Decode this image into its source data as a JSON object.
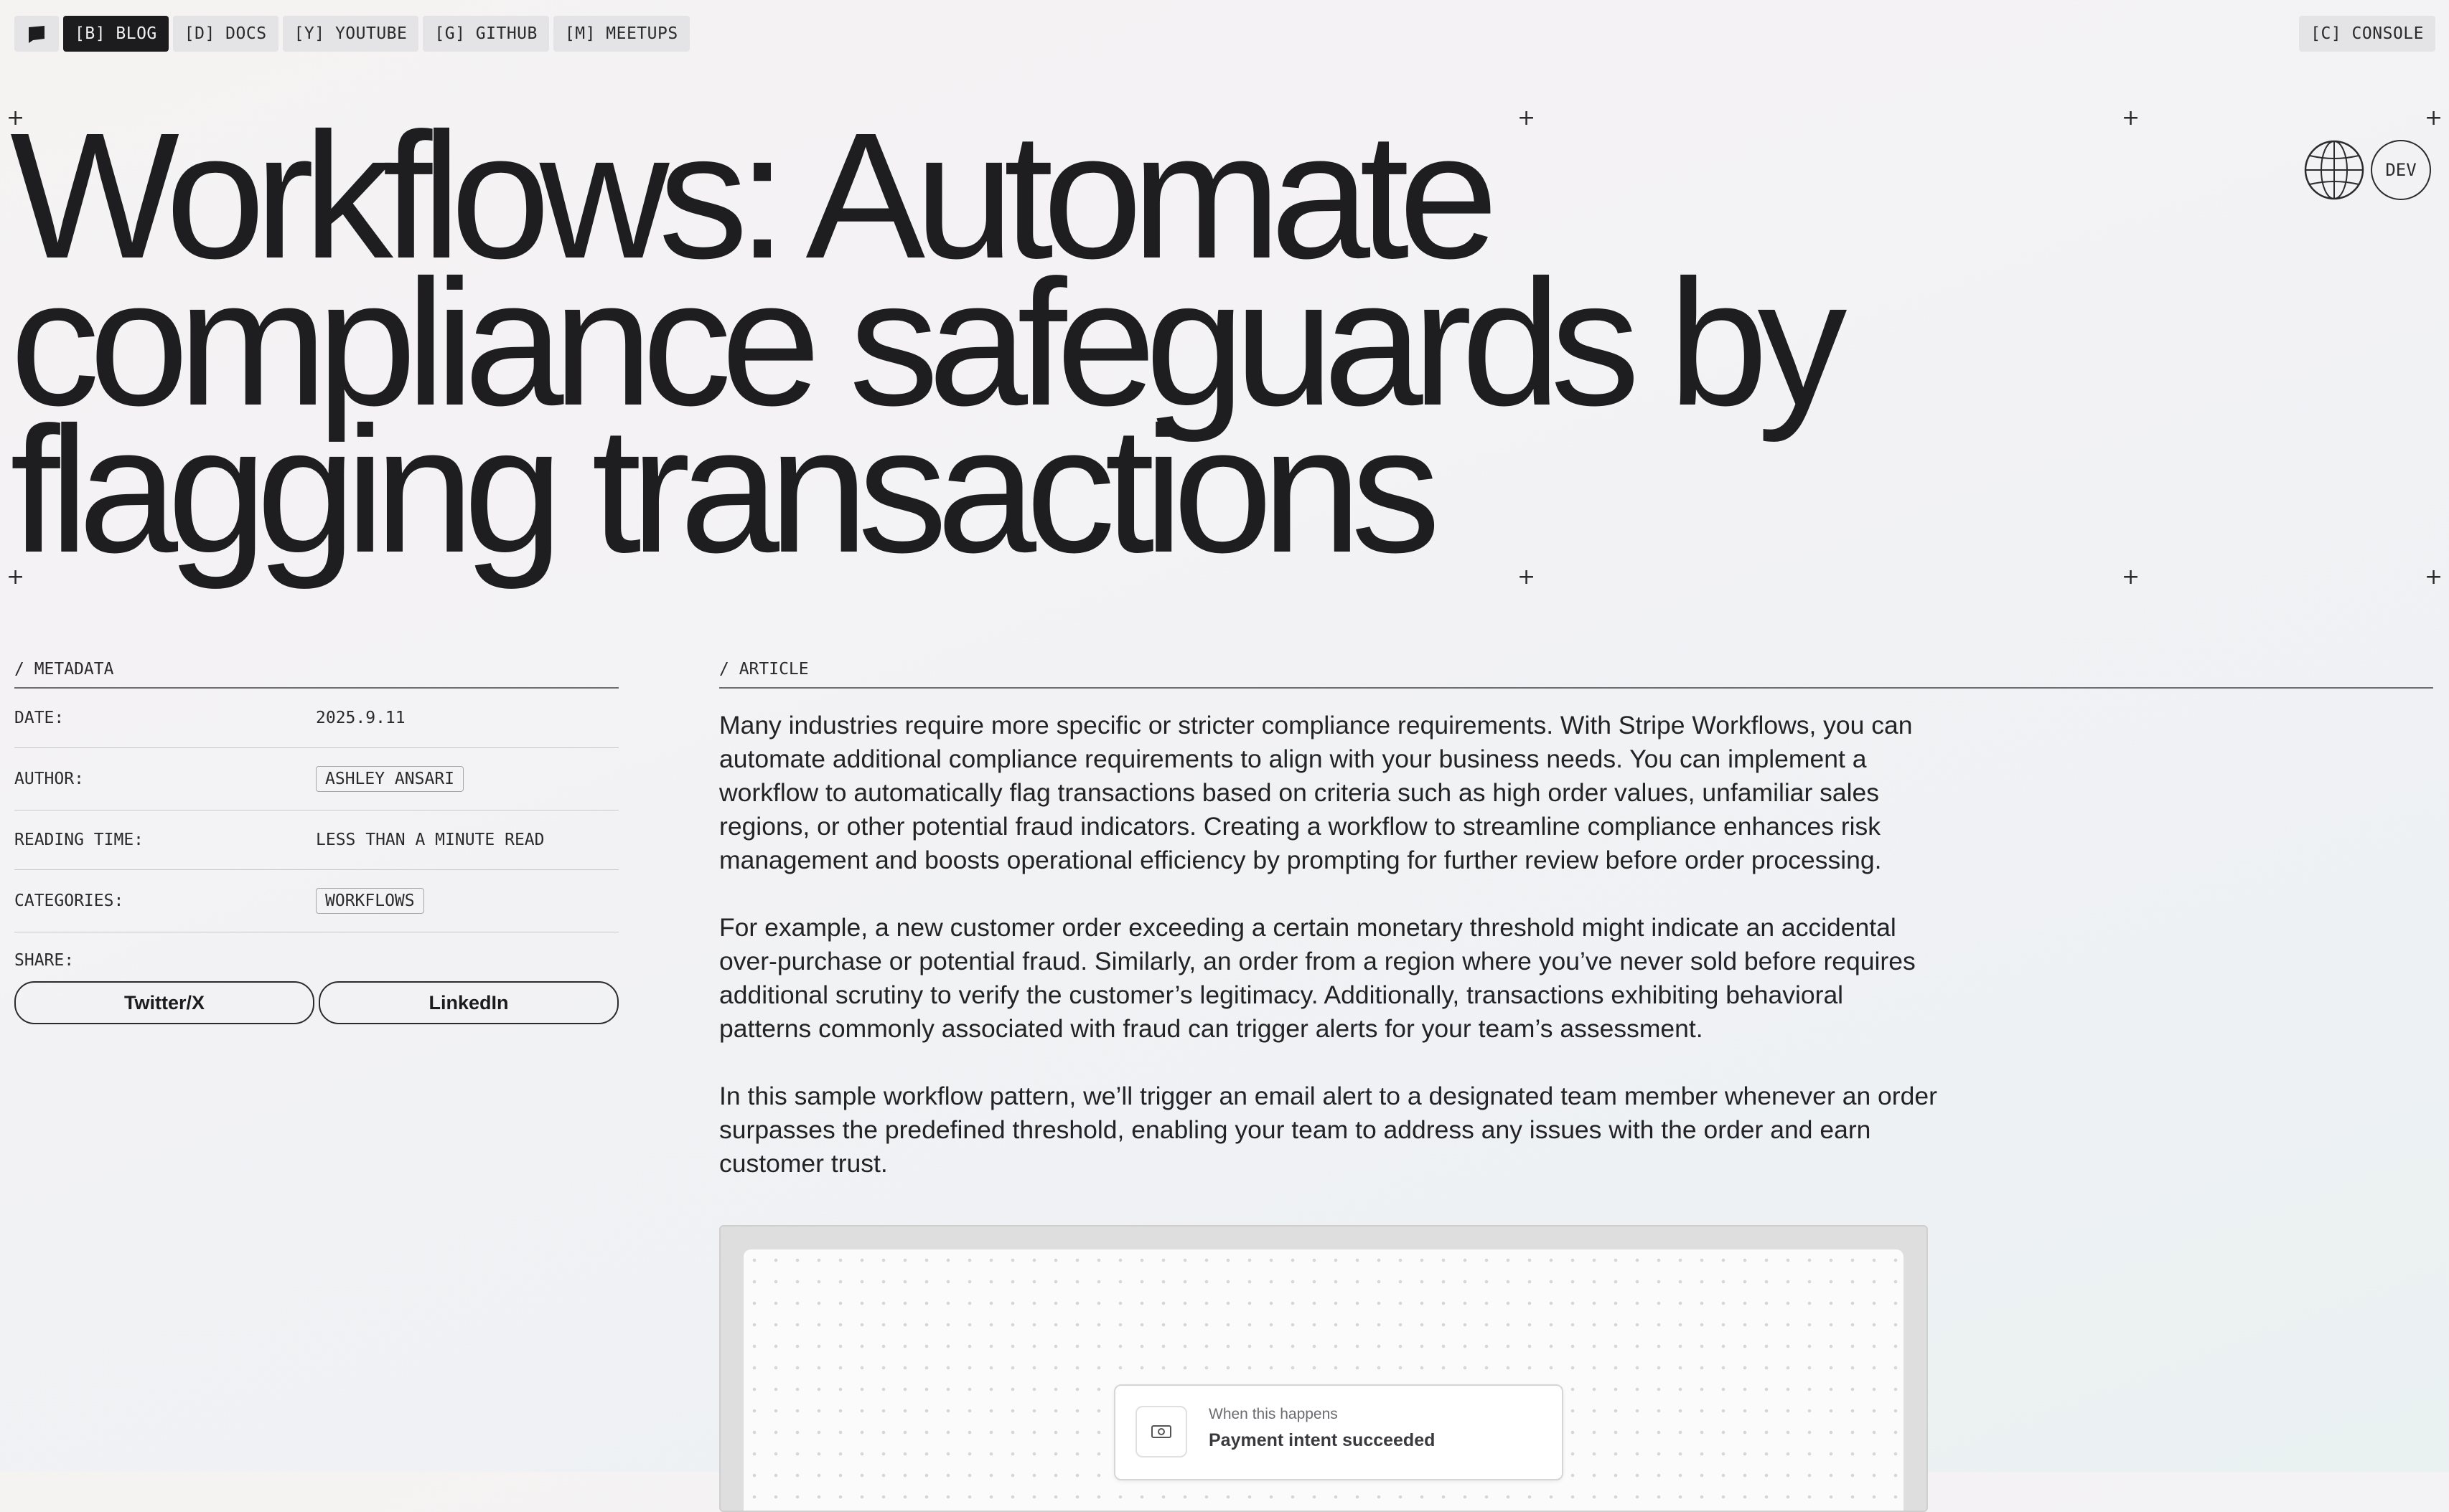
{
  "nav": {
    "items": [
      {
        "label": "[B] BLOG",
        "active": true
      },
      {
        "label": "[D] DOCS",
        "active": false
      },
      {
        "label": "[Y] YOUTUBE",
        "active": false
      },
      {
        "label": "[G] GITHUB",
        "active": false
      },
      {
        "label": "[M] MEETUPS",
        "active": false
      }
    ],
    "console_label": "[C] CONSOLE"
  },
  "hero": {
    "title": "Workflows: Automate compliance safeguards by flagging transactions",
    "dev_label": "DEV"
  },
  "metadata": {
    "section_label": "/ METADATA",
    "date_key": "DATE:",
    "date_value": "2025.9.11",
    "author_key": "AUTHOR:",
    "author_value": "ASHLEY ANSARI",
    "reading_key": "READING TIME:",
    "reading_value": "LESS THAN A MINUTE READ",
    "categories_key": "CATEGORIES:",
    "categories_value": "WORKFLOWS",
    "share_key": "SHARE:",
    "share_twitter": "Twitter/X",
    "share_linkedin": "LinkedIn"
  },
  "article": {
    "section_label": "/ ARTICLE",
    "paragraphs": [
      "Many industries require more specific or stricter compliance requirements. With Stripe Workflows, you can automate additional compliance requirements to align with your business needs. You can implement a workflow to automatically flag transactions based on criteria such as high order values, unfamiliar sales regions, or other potential fraud indicators. Creating a workflow to streamline compliance enhances risk management and boosts operational efficiency by prompting for further review before order processing.",
      "For example, a new customer order exceeding a certain monetary threshold might indicate an accidental over-purchase or potential fraud. Similarly, an order from a region where you’ve never sold before requires additional scrutiny to verify the customer’s legitimacy. Additionally, transactions exhibiting behavioral patterns commonly associated with fraud can trigger alerts for your team’s assessment.",
      "In this sample workflow pattern, we’ll trigger an email alert to a designated team member whenever an order surpasses the predefined threshold, enabling your team to address any issues with the order and earn customer trust."
    ]
  },
  "workflow_card": {
    "subtitle": "When this happens",
    "title": "Payment intent succeeded",
    "icon": "payment-icon"
  },
  "colors": {
    "text": "#1b1b1d",
    "active_nav_bg": "#1c1c1e",
    "nav_bg": "#e4e3e5"
  }
}
